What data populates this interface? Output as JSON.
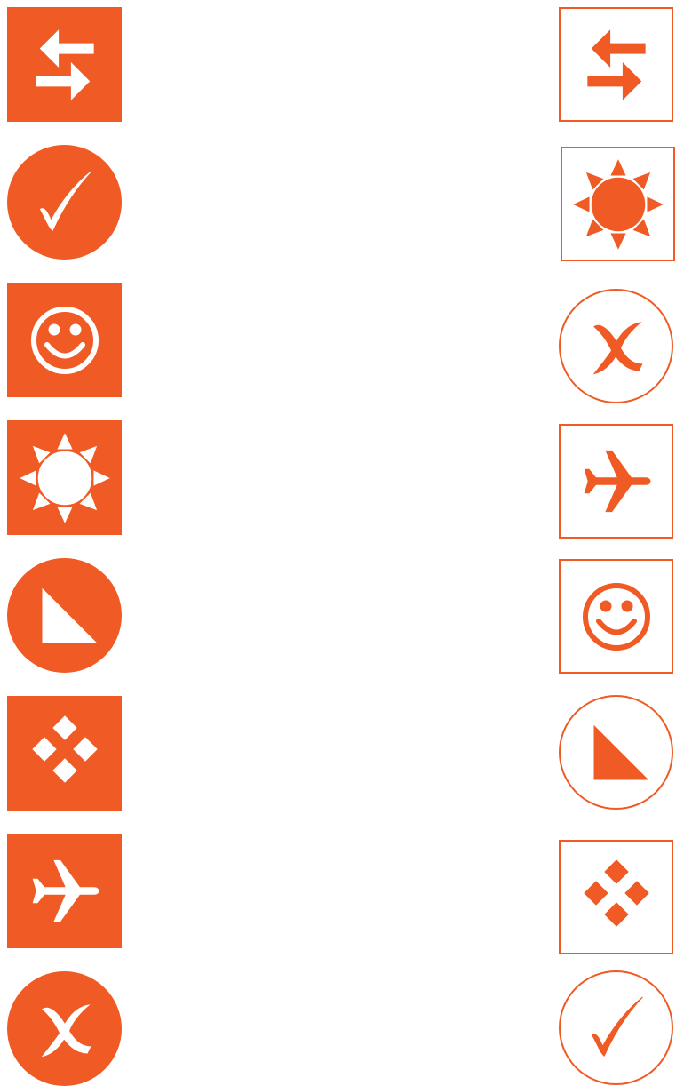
{
  "colors": {
    "accent": "#f05a24",
    "background": "#ffffff"
  },
  "left_column": [
    {
      "icon": "swap-arrows-icon",
      "shape": "square",
      "style": "filled"
    },
    {
      "icon": "checkmark-icon",
      "shape": "circle",
      "style": "filled"
    },
    {
      "icon": "smiley-face-icon",
      "shape": "square",
      "style": "filled"
    },
    {
      "icon": "sun-icon",
      "shape": "square",
      "style": "filled"
    },
    {
      "icon": "right-triangle-icon",
      "shape": "circle",
      "style": "filled"
    },
    {
      "icon": "four-diamonds-icon",
      "shape": "square",
      "style": "filled"
    },
    {
      "icon": "airplane-icon",
      "shape": "square",
      "style": "filled"
    },
    {
      "icon": "cross-mark-icon",
      "shape": "circle",
      "style": "filled"
    }
  ],
  "right_column": [
    {
      "icon": "swap-arrows-icon",
      "shape": "square",
      "style": "outlined"
    },
    {
      "icon": "sun-icon",
      "shape": "square",
      "style": "outlined"
    },
    {
      "icon": "cross-mark-icon",
      "shape": "circle",
      "style": "outlined"
    },
    {
      "icon": "airplane-icon",
      "shape": "square",
      "style": "outlined"
    },
    {
      "icon": "smiley-face-icon",
      "shape": "square",
      "style": "outlined"
    },
    {
      "icon": "right-triangle-icon",
      "shape": "circle",
      "style": "outlined"
    },
    {
      "icon": "four-diamonds-icon",
      "shape": "square",
      "style": "outlined"
    },
    {
      "icon": "checkmark-icon",
      "shape": "circle",
      "style": "outlined"
    }
  ]
}
